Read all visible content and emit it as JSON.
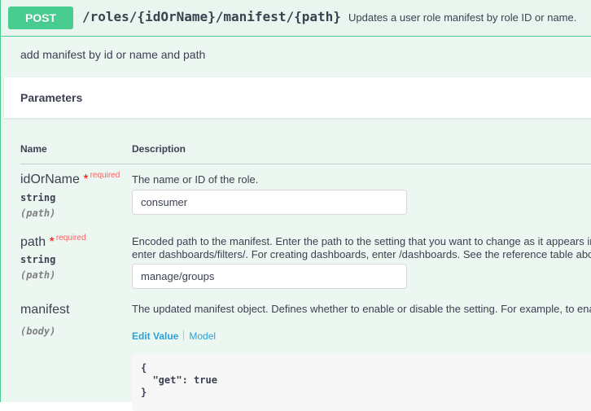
{
  "operation": {
    "method": "POST",
    "path": "/roles/{idOrName}/manifest/{path}",
    "summary": "Updates a user role manifest by role ID or name.",
    "description": "add manifest by id or name and path"
  },
  "parameters": {
    "title": "Parameters",
    "columns": {
      "name": "Name",
      "description": "Description"
    },
    "required_label": "required",
    "items": [
      {
        "name": "idOrName",
        "required": true,
        "type": "string",
        "in": "(path)",
        "description": "The name or ID of the role.",
        "value": "consumer"
      },
      {
        "name": "path",
        "required": true,
        "type": "string",
        "in": "(path)",
        "description_line1": "Encoded path to the manifest. Enter the path to the setting that you want to change as it appears in",
        "description_line2": "enter dashboards/filters/. For creating dashboards, enter /dashboards. See the reference table abo",
        "value": "manage/groups"
      },
      {
        "name": "manifest",
        "required": false,
        "in": "(body)",
        "description": "The updated manifest object. Defines whether to enable or disable the setting. For example, to ena",
        "tab_edit": "Edit Value",
        "tab_model": "Model",
        "code": "{\n  \"get\": true\n}"
      }
    ]
  },
  "colors": {
    "post": "#49cc90",
    "link": "#2ca0d8",
    "required": "#ff6060"
  }
}
